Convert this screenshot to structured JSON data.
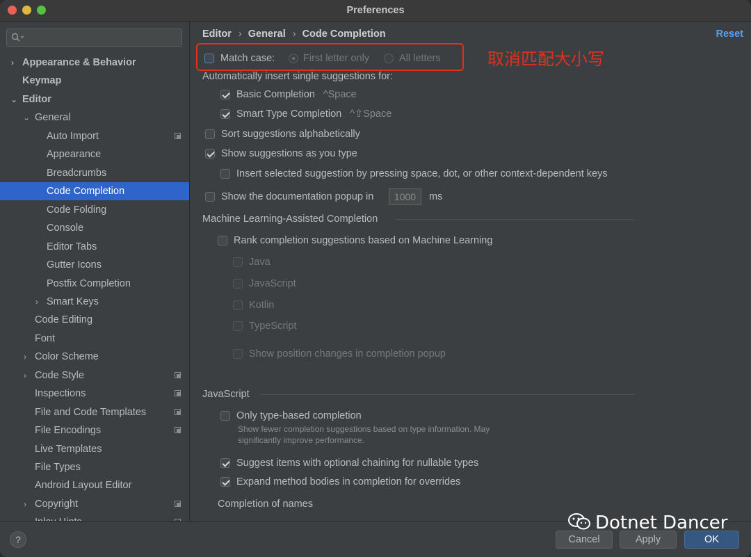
{
  "window": {
    "title": "Preferences"
  },
  "search": {
    "placeholder": ""
  },
  "sidebar": {
    "items": [
      {
        "label": "Appearance & Behavior",
        "chevron": ">"
      },
      {
        "label": "Keymap"
      },
      {
        "label": "Editor",
        "chevron": "v"
      },
      {
        "label": "General",
        "chevron": "v"
      },
      {
        "label": "Auto Import"
      },
      {
        "label": "Appearance"
      },
      {
        "label": "Breadcrumbs"
      },
      {
        "label": "Code Completion",
        "selected": true
      },
      {
        "label": "Code Folding"
      },
      {
        "label": "Console"
      },
      {
        "label": "Editor Tabs"
      },
      {
        "label": "Gutter Icons"
      },
      {
        "label": "Postfix Completion"
      },
      {
        "label": "Smart Keys",
        "chevron": ">"
      },
      {
        "label": "Code Editing"
      },
      {
        "label": "Font"
      },
      {
        "label": "Color Scheme",
        "chevron": ">"
      },
      {
        "label": "Code Style",
        "chevron": ">"
      },
      {
        "label": "Inspections"
      },
      {
        "label": "File and Code Templates"
      },
      {
        "label": "File Encodings"
      },
      {
        "label": "Live Templates"
      },
      {
        "label": "File Types"
      },
      {
        "label": "Android Layout Editor"
      },
      {
        "label": "Copyright",
        "chevron": ">"
      },
      {
        "label": "Inlay Hints",
        "chevron": ">"
      }
    ]
  },
  "breadcrumb": {
    "level1": "Editor",
    "level2": "General",
    "level3": "Code Completion",
    "separator": "›"
  },
  "reset_label": "Reset",
  "settings": {
    "match_case": "Match case:",
    "first_letter_only": "First letter only",
    "all_letters": "All letters",
    "auto_insert_header": "Automatically insert single suggestions for:",
    "basic_completion": "Basic Completion",
    "basic_shortcut": "^Space",
    "smart_type_completion": "Smart Type Completion",
    "smart_shortcut": "^⇧Space",
    "sort_alpha": "Sort suggestions alphabetically",
    "show_as_you_type": "Show suggestions as you type",
    "insert_selected": "Insert selected suggestion by pressing space, dot, or other context-dependent keys",
    "doc_popup": "Show the documentation popup in",
    "doc_popup_value": "1000",
    "doc_popup_unit": "ms",
    "ml_section": "Machine Learning-Assisted Completion",
    "ml_rank": "Rank completion suggestions based on Machine Learning",
    "ml_java": "Java",
    "ml_javascript": "JavaScript",
    "ml_kotlin": "Kotlin",
    "ml_typescript": "TypeScript",
    "ml_position": "Show position changes in completion popup",
    "js_section": "JavaScript",
    "js_type_based": "Only type-based completion",
    "js_type_note": "Show fewer completion suggestions based on type information. May significantly improve performance.",
    "js_optional_chaining": "Suggest items with optional chaining for nullable types",
    "js_expand_bodies": "Expand method bodies in completion for overrides",
    "completion_of_names": "Completion of names"
  },
  "annotation": {
    "text": "取消匹配大小写",
    "color": "#e0301e"
  },
  "buttons": {
    "cancel": "Cancel",
    "apply": "Apply",
    "ok": "OK",
    "help": "?"
  },
  "watermark": {
    "text": "Dotnet Dancer"
  },
  "colors": {
    "selection": "#2f65ca",
    "link": "#589df6",
    "ok_button": "#365880",
    "annotation_red": "#e0301e"
  }
}
